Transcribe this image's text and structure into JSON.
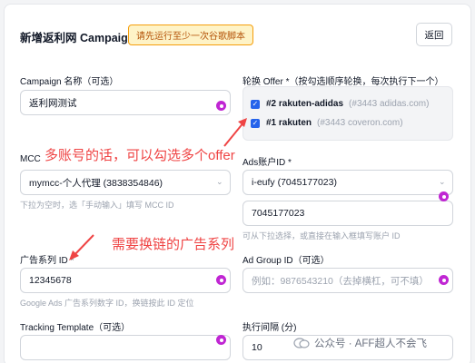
{
  "header": {
    "title": "新增返利网 Campaign",
    "warning": "请先运行至少一次谷歌脚本",
    "back_label": "返回"
  },
  "campaign_name": {
    "label": "Campaign 名称（可选）",
    "value": "返利网测试"
  },
  "rotation": {
    "label": "轮换 Offer *（按勾选顺序轮换，每次执行下一个）",
    "offers": [
      {
        "name": "#2 rakuten-adidas",
        "sub": "(#3443 adidas.com)",
        "checked": true
      },
      {
        "name": "#1 rakuten",
        "sub": "(#3443 coveron.com)",
        "checked": true
      }
    ]
  },
  "mcc": {
    "label": "MCC",
    "value": "mymcc-个人代理 (3838354846)",
    "hint": "下拉为空时，选「手动输入」填写 MCC ID"
  },
  "ads_account": {
    "label": "Ads账户ID *",
    "value": "i-eufy (7045177023)",
    "manual_value": "7045177023",
    "hint": "可从下拉选择，或直接在输入框填写账户 ID"
  },
  "campaign_id": {
    "label": "广告系列 ID *",
    "value": "12345678",
    "hint": "Google Ads 广告系列数字 ID，换链按此 ID 定位"
  },
  "ad_group": {
    "label": "Ad Group ID（可选）",
    "placeholder": "例如：9876543210（去掉横杠，可不填）"
  },
  "tracking": {
    "label": "Tracking Template（可选）",
    "value": ""
  },
  "interval": {
    "label": "执行间隔 (分)",
    "value": "10"
  },
  "annotations": {
    "multi_account": "多账号的话，可以勾选多个offer",
    "relink_campaign": "需要换链的广告系列"
  },
  "watermark": {
    "text": "公众号 · AFF超人不会飞"
  },
  "colors": {
    "accent": "#2563eb",
    "annotation": "#ef4444",
    "warning_border": "#f59e0b"
  }
}
